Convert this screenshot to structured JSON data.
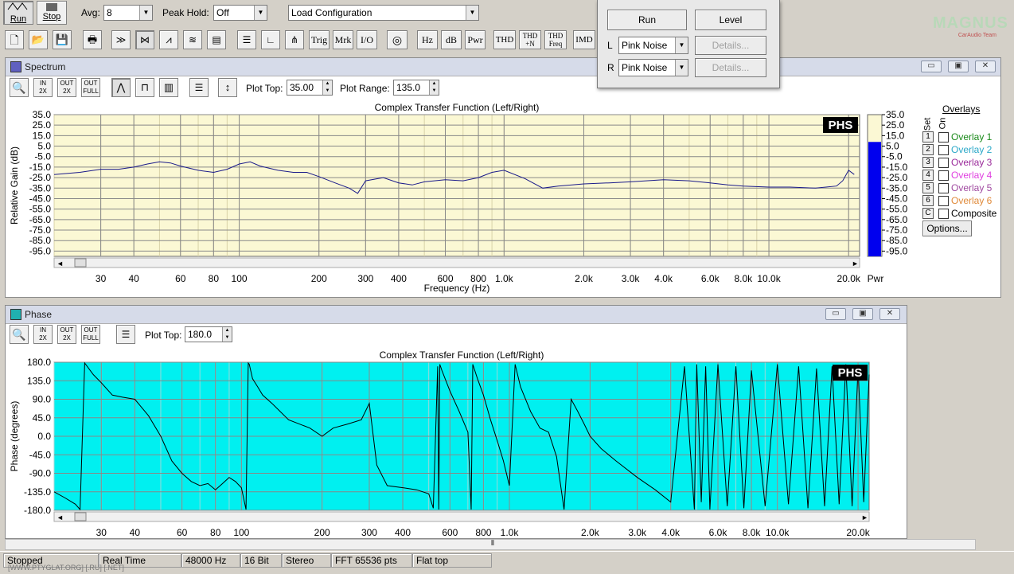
{
  "toolbar_top": {
    "run_label": "Run",
    "stop_label": "Stop",
    "avg_label": "Avg:",
    "avg_value": "8",
    "peak_hold_label": "Peak Hold:",
    "peak_hold_value": "Off",
    "config_value": "Load Configuration"
  },
  "toolbar_icons": {
    "trig": "Trig",
    "mrk": "Mrk",
    "io": "I/O",
    "hz": "Hz",
    "db": "dB",
    "pwr": "Pwr",
    "thd": "THD",
    "thdn_top": "THD",
    "thdn_bottom": "+N",
    "thdfreq_top": "THD",
    "thdfreq_bottom": "Freq",
    "imd": "IMD"
  },
  "logo": {
    "top": "MAGNUS",
    "bottom": "CarAudio Team"
  },
  "generator_panel": {
    "run_label": "Run",
    "level_label": "Level",
    "l_label": "L",
    "r_label": "R",
    "l_signal": "Pink Noise",
    "r_signal": "Pink Noise",
    "details_label": "Details..."
  },
  "spectrum": {
    "window_title": "Spectrum",
    "plot_top_label": "Plot Top:",
    "plot_top_value": "35.00",
    "plot_range_label": "Plot Range:",
    "plot_range_value": "135.0",
    "zoom_in_top": "IN",
    "zoom_in_bottom": "2X",
    "zoom_out_top": "OUT",
    "zoom_out_bottom": "2X",
    "zoom_full_top": "OUT",
    "zoom_full_bottom": "FULL",
    "pwr_label": "Pwr",
    "badge": "PHS",
    "overlays_title": "Overlays",
    "set_label": "Set",
    "on_label": "On",
    "overlays": [
      {
        "num": "1",
        "name": "Overlay 1",
        "color": "#1a8a1a"
      },
      {
        "num": "2",
        "name": "Overlay 2",
        "color": "#2aa8c8"
      },
      {
        "num": "3",
        "name": "Overlay 3",
        "color": "#9a2a9a"
      },
      {
        "num": "4",
        "name": "Overlay 4",
        "color": "#e040e0"
      },
      {
        "num": "5",
        "name": "Overlay 5",
        "color": "#a04aa0"
      },
      {
        "num": "6",
        "name": "Overlay 6",
        "color": "#e08a3a"
      },
      {
        "num": "C",
        "name": "Composite",
        "color": "#000000"
      }
    ],
    "options_label": "Options..."
  },
  "phase": {
    "window_title": "Phase",
    "plot_top_label": "Plot Top:",
    "plot_top_value": "180.0",
    "badge": "PHS"
  },
  "status_bar": {
    "state": "Stopped",
    "mode": "Real Time",
    "rate": "48000 Hz",
    "bits": "16 Bit",
    "channels": "Stereo",
    "fft": "FFT 65536 pts",
    "window": "Flat top",
    "watermark": "[WWW.PTYGLAT.ORG] [.RU] [.NET]"
  },
  "chart_data": [
    {
      "type": "line",
      "title": "Complex Transfer Function (Left/Right)",
      "xlabel": "Frequency (Hz)",
      "ylabel": "Relative Gain (dB)",
      "x_scale": "log",
      "xlim": [
        20,
        22000
      ],
      "ylim": [
        -100,
        35
      ],
      "yticks": [
        "35.0",
        "25.0",
        "15.0",
        "5.0",
        "-5.0",
        "-15.0",
        "-25.0",
        "-35.0",
        "-45.0",
        "-55.0",
        "-65.0",
        "-75.0",
        "-85.0",
        "-95.0"
      ],
      "xticks": [
        {
          "v": 30,
          "t": "30"
        },
        {
          "v": 40,
          "t": "40"
        },
        {
          "v": 60,
          "t": "60"
        },
        {
          "v": 80,
          "t": "80"
        },
        {
          "v": 100,
          "t": "100"
        },
        {
          "v": 200,
          "t": "200"
        },
        {
          "v": 300,
          "t": "300"
        },
        {
          "v": 400,
          "t": "400"
        },
        {
          "v": 600,
          "t": "600"
        },
        {
          "v": 800,
          "t": "800"
        },
        {
          "v": 1000,
          "t": "1.0k"
        },
        {
          "v": 2000,
          "t": "2.0k"
        },
        {
          "v": 3000,
          "t": "3.0k"
        },
        {
          "v": 4000,
          "t": "4.0k"
        },
        {
          "v": 6000,
          "t": "6.0k"
        },
        {
          "v": 8000,
          "t": "8.0k"
        },
        {
          "v": 10000,
          "t": "10.0k"
        },
        {
          "v": 20000,
          "t": "20.0k"
        }
      ],
      "grid": true,
      "line_color": "#1a1a8a",
      "background_color": "#fbf8d4",
      "series": [
        {
          "x": [
            20,
            25,
            30,
            35,
            40,
            45,
            50,
            55,
            60,
            70,
            80,
            90,
            100,
            110,
            120,
            140,
            160,
            180,
            200,
            230,
            260,
            280,
            300,
            350,
            400,
            450,
            500,
            600,
            700,
            800,
            900,
            1000,
            1200,
            1400,
            1600,
            2000,
            2500,
            3000,
            4000,
            5000,
            6000,
            7000,
            8000,
            10000,
            12000,
            15000,
            18000,
            19000,
            20000,
            21000
          ],
          "y": [
            -22,
            -20,
            -17,
            -17,
            -15,
            -12,
            -10,
            -11,
            -14,
            -18,
            -20,
            -17,
            -12,
            -10,
            -14,
            -18,
            -20,
            -20,
            -24,
            -30,
            -35,
            -40,
            -28,
            -25,
            -30,
            -32,
            -29,
            -27,
            -28,
            -25,
            -20,
            -18,
            -26,
            -35,
            -33,
            -31,
            -30,
            -29,
            -27,
            -28,
            -30,
            -32,
            -33,
            -34,
            -34,
            -35,
            -33,
            -28,
            -18,
            -22
          ]
        }
      ],
      "level_meter": {
        "label": "Pwr",
        "value_db": 9
      }
    },
    {
      "type": "line",
      "title": "Complex Transfer Function (Left/Right)",
      "xlabel": "",
      "ylabel": "Phase (degrees)",
      "x_scale": "log",
      "xlim": [
        20,
        22000
      ],
      "ylim": [
        -180,
        180
      ],
      "yticks": [
        "180.0",
        "135.0",
        "90.0",
        "45.0",
        "0.0",
        "-45.0",
        "-90.0",
        "-135.0",
        "-180.0"
      ],
      "xticks": [
        {
          "v": 30,
          "t": "30"
        },
        {
          "v": 40,
          "t": "40"
        },
        {
          "v": 60,
          "t": "60"
        },
        {
          "v": 80,
          "t": "80"
        },
        {
          "v": 100,
          "t": "100"
        },
        {
          "v": 200,
          "t": "200"
        },
        {
          "v": 300,
          "t": "300"
        },
        {
          "v": 400,
          "t": "400"
        },
        {
          "v": 600,
          "t": "600"
        },
        {
          "v": 800,
          "t": "800"
        },
        {
          "v": 1000,
          "t": "1.0k"
        },
        {
          "v": 2000,
          "t": "2.0k"
        },
        {
          "v": 3000,
          "t": "3.0k"
        },
        {
          "v": 4000,
          "t": "4.0k"
        },
        {
          "v": 6000,
          "t": "6.0k"
        },
        {
          "v": 8000,
          "t": "8.0k"
        },
        {
          "v": 10000,
          "t": "10.0k"
        },
        {
          "v": 20000,
          "t": "20.0k"
        }
      ],
      "grid": true,
      "line_color": "#000000",
      "background_color": "#00f0f0",
      "series": [
        {
          "x": [
            20,
            22,
            24,
            25,
            26,
            28,
            30,
            33,
            36,
            40,
            45,
            50,
            55,
            60,
            65,
            70,
            75,
            80,
            85,
            90,
            95,
            100,
            104,
            106,
            107,
            110,
            115,
            120,
            130,
            150,
            180,
            200,
            220,
            250,
            280,
            300,
            320,
            350,
            400,
            450,
            500,
            520,
            540,
            545,
            550,
            560,
            600,
            650,
            700,
            720,
            730,
            760,
            800,
            850,
            900,
            950,
            1000,
            1050,
            1100,
            1200,
            1300,
            1400,
            1500,
            1600,
            1700,
            1800,
            1900,
            2000,
            2200,
            2500,
            3000,
            3500,
            4000,
            4500,
            4900,
            5000,
            5200,
            5400,
            5600,
            6000,
            6500,
            7000,
            7500,
            8000,
            9000,
            10000,
            11000,
            12000,
            13000,
            14000,
            15000,
            16000,
            17000,
            18000,
            19000,
            20000,
            21000,
            22000
          ],
          "y": [
            -135,
            -150,
            -165,
            -178,
            178,
            150,
            130,
            100,
            95,
            90,
            50,
            0,
            -60,
            -90,
            -110,
            -120,
            -115,
            -130,
            -115,
            -100,
            -110,
            -125,
            -178,
            178,
            175,
            140,
            120,
            100,
            80,
            40,
            20,
            0,
            20,
            30,
            40,
            80,
            -70,
            -120,
            -125,
            -130,
            -140,
            -175,
            170,
            -178,
            175,
            160,
            110,
            60,
            10,
            -178,
            175,
            140,
            100,
            40,
            -10,
            -60,
            -120,
            175,
            120,
            60,
            20,
            10,
            -50,
            -178,
            90,
            60,
            30,
            0,
            -30,
            -60,
            -100,
            -130,
            -160,
            170,
            -178,
            175,
            -160,
            170,
            -178,
            175,
            -170,
            170,
            -175,
            160,
            -170,
            175,
            -165,
            170,
            -175,
            165,
            -170,
            170,
            -165,
            175,
            -170,
            168,
            -160,
            150
          ]
        }
      ]
    }
  ]
}
